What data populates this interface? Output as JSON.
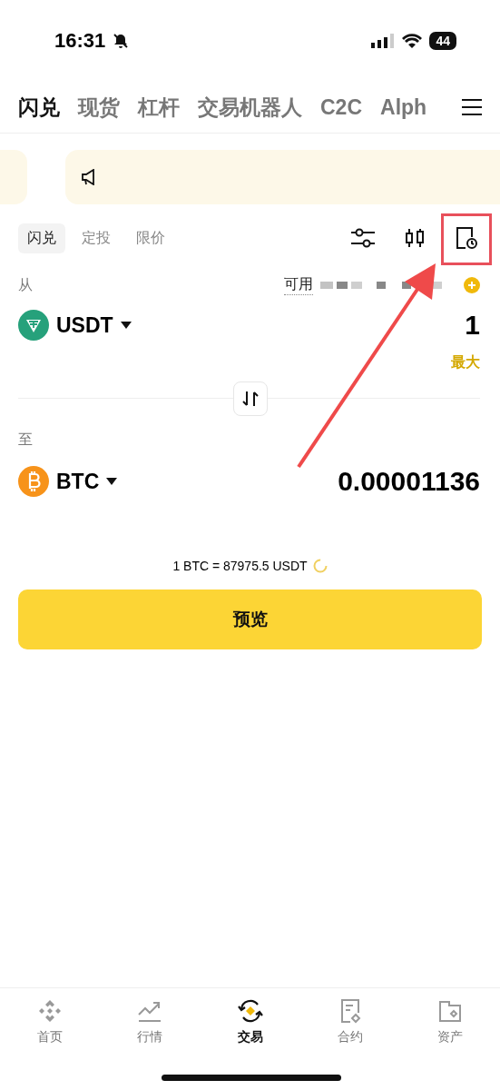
{
  "status_bar": {
    "time": "16:31",
    "battery": "44"
  },
  "top_tabs": [
    {
      "label": "闪兑",
      "selected": true
    },
    {
      "label": "现货",
      "selected": false
    },
    {
      "label": "杠杆",
      "selected": false
    },
    {
      "label": "交易机器人",
      "selected": false
    },
    {
      "label": "C2C",
      "selected": false
    },
    {
      "label": "Alph",
      "selected": false
    }
  ],
  "sub_tabs": [
    {
      "label": "闪兑",
      "selected": true
    },
    {
      "label": "定投",
      "selected": false
    },
    {
      "label": "限价",
      "selected": false
    }
  ],
  "from": {
    "label": "从",
    "available_label": "可用",
    "coin": "USDT",
    "amount": "1",
    "max": "最大"
  },
  "to": {
    "label": "至",
    "coin": "BTC",
    "amount": "0.00001136"
  },
  "rate": "1 BTC = 87975.5 USDT",
  "preview_button": "预览",
  "bottom_nav": [
    {
      "label": "首页",
      "selected": false
    },
    {
      "label": "行情",
      "selected": false
    },
    {
      "label": "交易",
      "selected": true
    },
    {
      "label": "合约",
      "selected": false
    },
    {
      "label": "资产",
      "selected": false
    }
  ]
}
